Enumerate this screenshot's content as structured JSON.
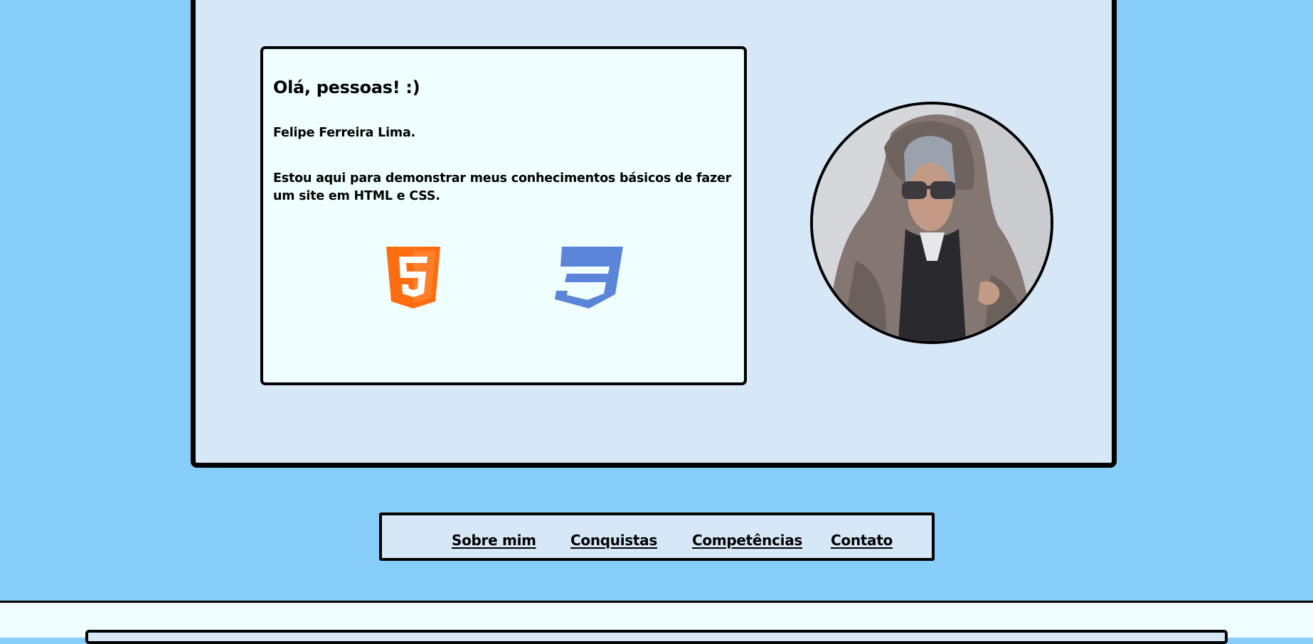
{
  "intro": {
    "greeting": "Olá, pessoas! :)",
    "name": "Felipe Ferreira Lima.",
    "description": "Estou aqui para demonstrar meus conhecimentos básicos de fazer um site em HTML e CSS."
  },
  "logos": [
    {
      "icon": "html5-icon",
      "color": "#ff6d10"
    },
    {
      "icon": "css3-icon",
      "color": "#5b85d8"
    }
  ],
  "nav": {
    "items": [
      {
        "label": "Sobre mim"
      },
      {
        "label": "Conquistas"
      },
      {
        "label": "Competências"
      },
      {
        "label": "Contato"
      }
    ]
  },
  "colors": {
    "page_background": "#87cdf9",
    "card_background": "#d6e8f8",
    "box_background": "#efffff",
    "border": "#000000"
  }
}
